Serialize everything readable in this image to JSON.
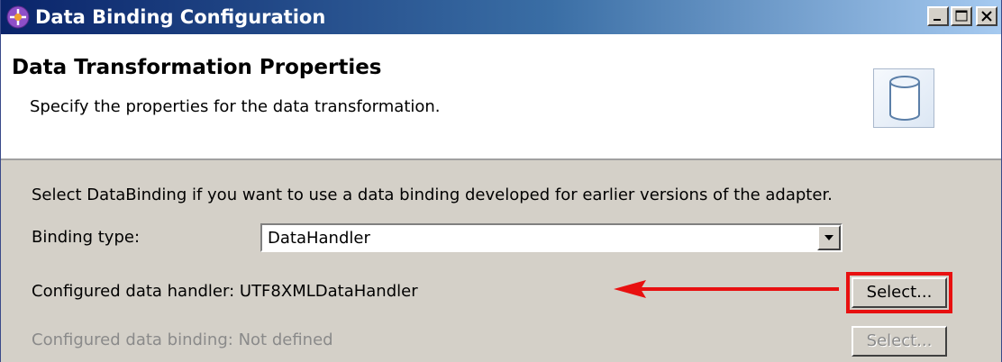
{
  "window": {
    "title": "Data Binding Configuration",
    "controls": [
      "minimize-icon",
      "maximize-icon",
      "close-icon"
    ]
  },
  "header": {
    "title": "Data Transformation Properties",
    "description": "Specify the properties for the data transformation.",
    "graphic_icon": "database-cylinder-icon"
  },
  "body": {
    "intro": "Select DataBinding if you want to use a data binding developed for earlier versions of the adapter.",
    "binding_type": {
      "label": "Binding type:",
      "value": "DataHandler"
    },
    "data_handler": {
      "label": "Configured data handler:",
      "value": "UTF8XMLDataHandler",
      "button_label": "Select..."
    },
    "data_binding": {
      "label": "Configured data binding:",
      "value": "Not defined",
      "button_label": "Select...",
      "disabled": true
    }
  },
  "annotation": {
    "color": "#e81010",
    "target": "data_handler select button"
  }
}
